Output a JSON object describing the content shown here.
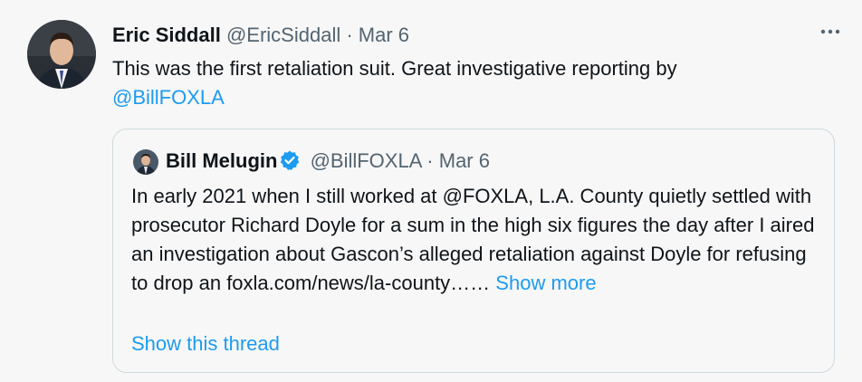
{
  "tweet": {
    "author_name": "Eric Siddall",
    "author_handle": "@EricSiddall",
    "separator": "·",
    "date": "Mar 6",
    "more_icon": "more-horizontal-icon",
    "text_before": "This was the first retaliation suit. Great investigative reporting by ",
    "mention": "@BillFOXLA"
  },
  "quoted": {
    "author_name": "Bill Melugin",
    "verified_icon": "verified-badge-icon",
    "author_handle": "@BillFOXLA",
    "separator": "·",
    "date": "Mar 6",
    "text": "In early 2021 when I still worked at @FOXLA, L.A. County quietly settled with prosecutor Richard Doyle for a sum in the high six figures the day after I aired an investigation about Gascon’s alleged retaliation against Doyle for refusing to drop an foxla.com/news/la-county…… ",
    "show_more": "Show more",
    "show_thread": "Show this thread"
  },
  "colors": {
    "background": "#f7f7f7",
    "accent": "#1d9bf0",
    "muted": "#536471",
    "border": "#cfd9de"
  }
}
